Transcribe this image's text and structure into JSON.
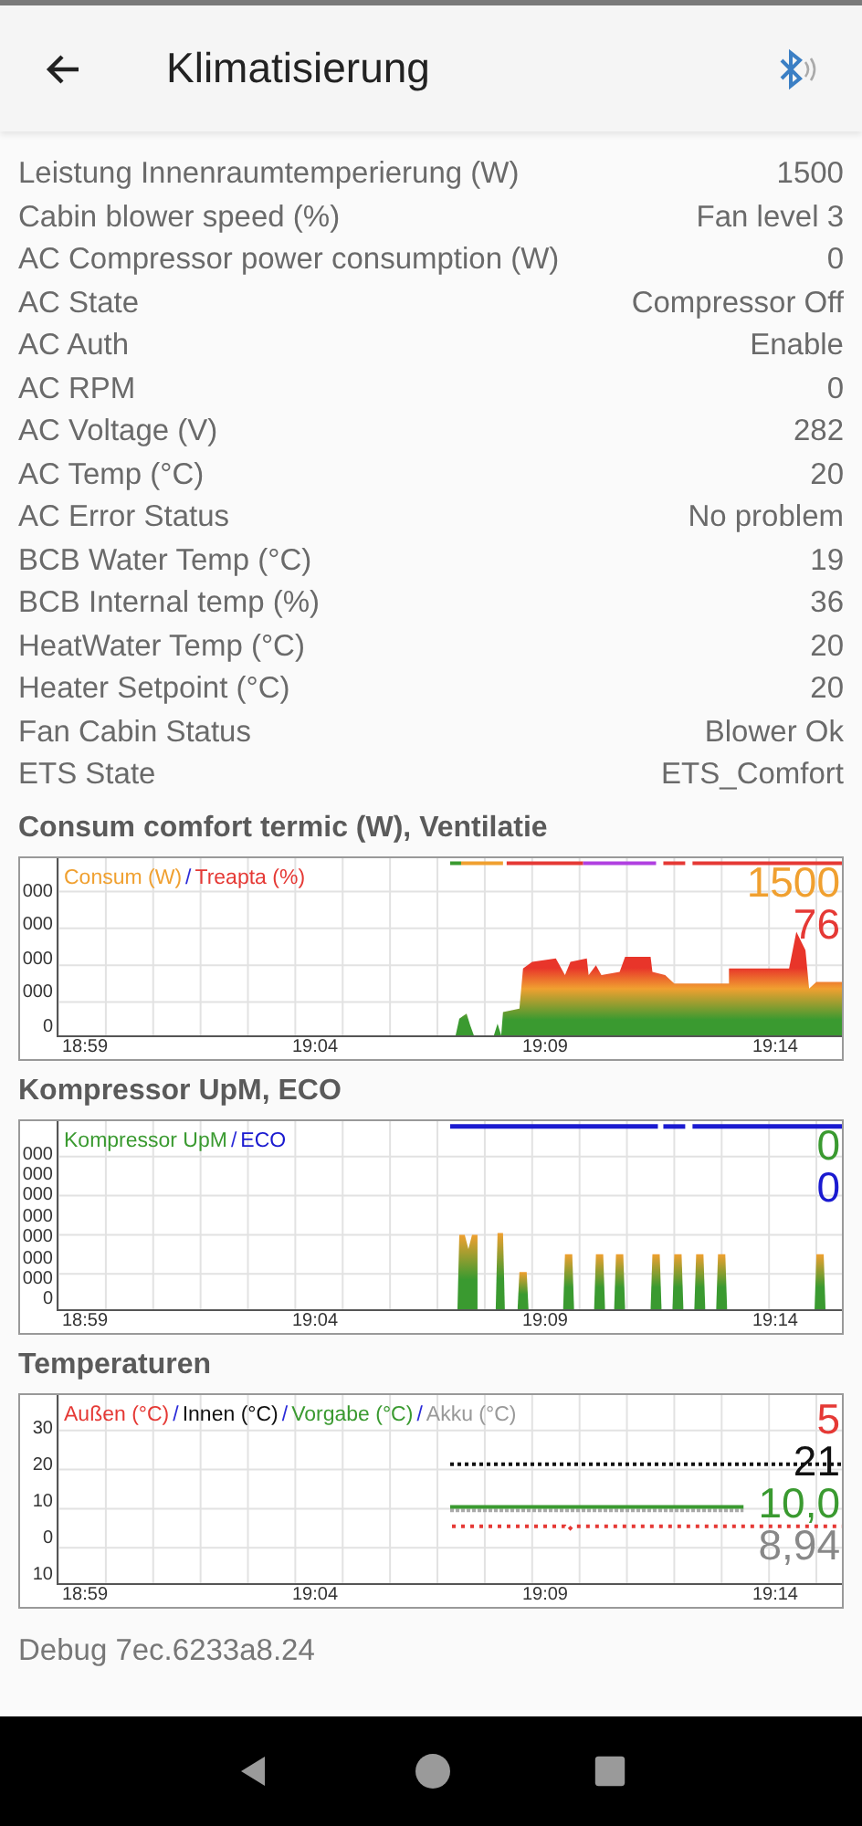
{
  "header": {
    "title": "Klimatisierung"
  },
  "rows": [
    {
      "label": "Leistung Innenraumtemperierung (W)",
      "value": "1500"
    },
    {
      "label": "Cabin blower speed (%)",
      "value": "Fan level 3"
    },
    {
      "label": "AC Compressor power consumption (W)",
      "value": "0"
    },
    {
      "label": "AC State",
      "value": "Compressor Off"
    },
    {
      "label": "AC Auth",
      "value": "Enable"
    },
    {
      "label": "AC RPM",
      "value": "0"
    },
    {
      "label": "AC Voltage (V)",
      "value": "282"
    },
    {
      "label": "AC Temp (°C)",
      "value": "20"
    },
    {
      "label": "AC Error Status",
      "value": "No problem"
    },
    {
      "label": "BCB Water Temp (°C)",
      "value": "19"
    },
    {
      "label": "BCB Internal temp (%)",
      "value": "36"
    },
    {
      "label": "HeatWater Temp (°C)",
      "value": "20"
    },
    {
      "label": "Heater Setpoint (°C)",
      "value": "20"
    },
    {
      "label": "Fan Cabin Status",
      "value": "Blower Ok"
    },
    {
      "label": "ETS State",
      "value": "ETS_Comfort"
    }
  ],
  "charts": [
    {
      "kind": "power",
      "title": "Consum comfort termic (W), Ventilatie",
      "separator": "/",
      "legend": [
        {
          "label": "Consum (W)",
          "color": "#f0a030"
        },
        {
          "label": "Treapta (%)",
          "color": "#e53935"
        }
      ],
      "readouts": [
        {
          "text": "1500",
          "color": "#f0a030"
        },
        {
          "text": "76",
          "color": "#e53935"
        }
      ],
      "y_labels": [
        "000",
        "000",
        "000",
        "000",
        "0"
      ],
      "x_labels": [
        "18:59",
        "19:04",
        "19:09",
        "19:14"
      ]
    },
    {
      "kind": "compressor",
      "title": "Kompressor UpM, ECO",
      "separator": "/",
      "legend": [
        {
          "label": "Kompressor UpM",
          "color": "#3a9a30"
        },
        {
          "label": "ECO",
          "color": "#1a1ad0"
        }
      ],
      "readouts": [
        {
          "text": "0",
          "color": "#3a9a30"
        },
        {
          "text": "0",
          "color": "#1a1ad0"
        }
      ],
      "y_labels": [
        "000",
        "000",
        "000",
        "000",
        "000",
        "000",
        "000",
        "0"
      ],
      "x_labels": [
        "18:59",
        "19:04",
        "19:09",
        "19:14"
      ]
    },
    {
      "kind": "temperature",
      "title": "Temperaturen",
      "separator": "/",
      "legend": [
        {
          "label": "Außen (°C)",
          "color": "#e53935"
        },
        {
          "label": "Innen (°C)",
          "color": "#111111"
        },
        {
          "label": "Vorgabe (°C)",
          "color": "#3a9a30"
        },
        {
          "label": "Akku (°C)",
          "color": "#999999"
        }
      ],
      "readouts": [
        {
          "text": "5",
          "color": "#e53935"
        },
        {
          "text": "21",
          "color": "#111111"
        },
        {
          "text": "10,0",
          "color": "#3a9a30"
        },
        {
          "text": "8,94",
          "color": "#888888"
        }
      ],
      "y_labels": [
        "30",
        "20",
        "10",
        "0",
        "10"
      ],
      "x_labels": [
        "18:59",
        "19:04",
        "19:09",
        "19:14"
      ]
    }
  ],
  "debug": "Debug 7ec.6233a8.24"
}
